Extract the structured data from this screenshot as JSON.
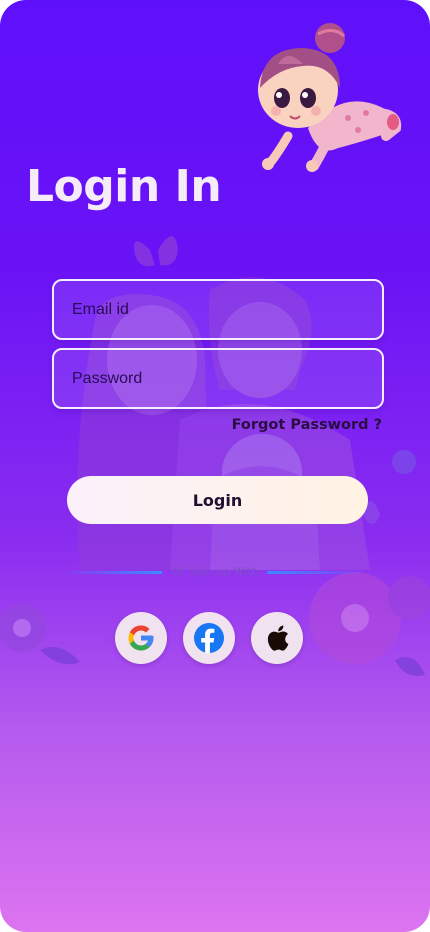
{
  "screen": {
    "title": "Login In"
  },
  "form": {
    "email_placeholder": "Email id",
    "password_placeholder": "Password",
    "forgot_label": "Forgot Password ?",
    "login_label": "Login"
  },
  "social": {
    "divider_label": "Or Sign up With",
    "providers": [
      {
        "name": "google",
        "icon": "google-icon"
      },
      {
        "name": "facebook",
        "icon": "facebook-icon"
      },
      {
        "name": "apple",
        "icon": "apple-icon"
      }
    ]
  },
  "colors": {
    "background_top": "#5f10fb",
    "background_bottom": "#dd74f0",
    "title_text": "#f6ecf8",
    "field_border": "#f4ecff",
    "login_button": "#fff3e2",
    "social_button": "#f1e2ef",
    "google_blue": "#4285f4",
    "google_red": "#ea4335",
    "google_yellow": "#fbbc05",
    "google_green": "#34a853",
    "facebook_blue": "#1877f2",
    "apple_black": "#1a0a05"
  }
}
